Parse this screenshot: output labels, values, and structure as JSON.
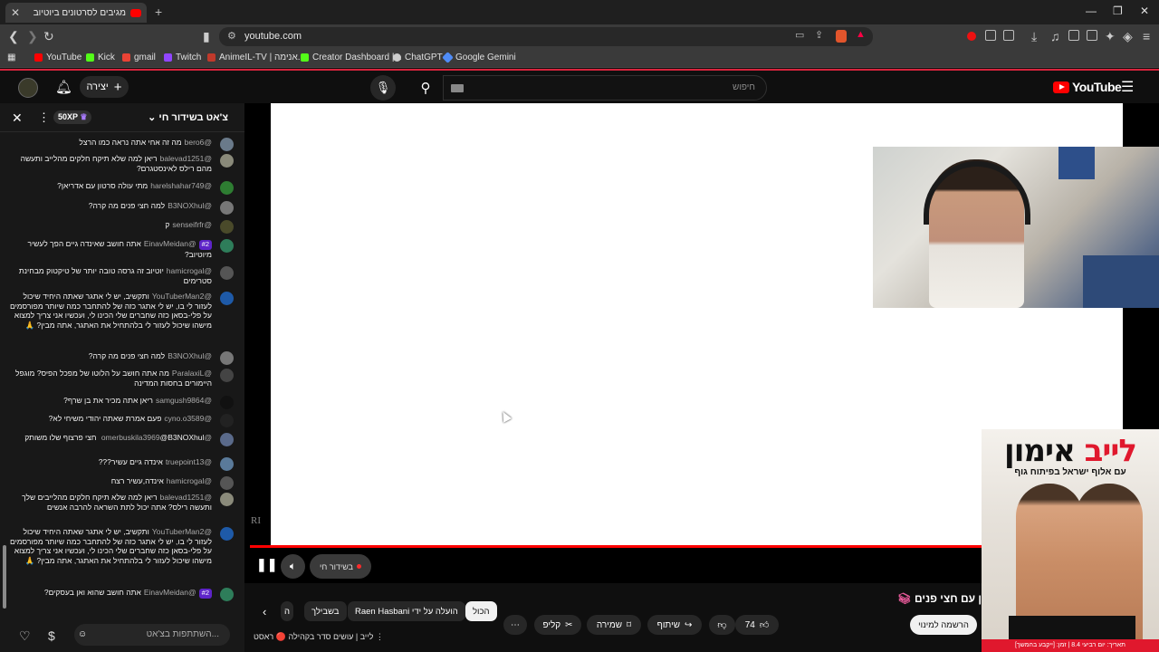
{
  "browser": {
    "tab_title": "מגיבים לסרטונים ביוטיוב",
    "url": "youtube.com",
    "bookmarks": [
      {
        "label": "YouTube",
        "color": "#ff0000"
      },
      {
        "label": "Kick",
        "color": "#53fc18"
      },
      {
        "label": "gmail",
        "color": "#ea4335"
      },
      {
        "label": "Twitch",
        "color": "#9146ff"
      },
      {
        "label": "AnimeIL-TV | אנימה...",
        "color": "#c0392b"
      },
      {
        "label": "Creator Dashboard |...",
        "color": "#53fc18"
      },
      {
        "label": "ChatGPT",
        "color": "#cccccc"
      },
      {
        "label": "Google Gemini",
        "color": "#4f8cf7"
      }
    ]
  },
  "header": {
    "create_label": "יצירה",
    "search_placeholder": "חיפוש",
    "logo_text": "YouTube"
  },
  "chat": {
    "title": "צ'אט בשידור חי",
    "xp_badge": "50XP",
    "input_placeholder": "השתתפות בצ'אט...",
    "messages": [
      {
        "author": "@bero6",
        "text": "מה זה אחי אתה נראה כמו הרצל",
        "avatar_color": "#6a7a8a"
      },
      {
        "author": "@balevad1251",
        "text": "ריאן למה שלא תיקח חלקים מהלייב ותעשה מהם רילס לאינסטגרם?",
        "avatar_color": "#8a8a7a"
      },
      {
        "author": "@harelshahar749",
        "text": "מתי עולה סרטון עם אדריאן?",
        "avatar_color": "#2e7d32"
      },
      {
        "author": "@B3NOXhul",
        "text": "למה חצי פנים מה קרה?",
        "avatar_color": "#777777"
      },
      {
        "author": "@senseifrfr",
        "text": "ק",
        "avatar_color": "#4a4a2a"
      },
      {
        "author": "@EinavMeidan",
        "badge": "#2",
        "text": "אתה חושב שאינדה גיים הפך לעשיר מיוטיוב?",
        "avatar_color": "#2e7d5a"
      },
      {
        "author": "@hamicrogal",
        "text": "יוטיוב זה גרסה טובה יותר של טיקטוק מבחינת סטרימים",
        "avatar_color": "#555555"
      },
      {
        "author": "@YouTuberMan2",
        "text": "ותקשיב, יש לי אתגר שאתה היחיד שיכול לעזור לי בו, יש לי אתגר כזה של להתחבר כמה שיותר מפורסמים על פלי-בסאן כזה שחברים שלי הכינו לי, ועכשיו אני צריך למצוא מישהו שיכול לעזור לי בלהתחיל את האתגר, אתה מבין? 🙏",
        "avatar_color": "#1e5aa8"
      },
      {
        "author": "@B3NOXhul",
        "text": "למה חצי פנים מה קרה?",
        "avatar_color": "#777777"
      },
      {
        "author": "@ParalaxiL",
        "text": "מה אתה חושב על הלוטו של מפכל הפיס? מוגפל היימורים בחסות המדינה",
        "avatar_color": "#444444"
      },
      {
        "author": "@samgush9864",
        "text": "ריאן אתה מכיר את בן שרף?",
        "avatar_color": "#111111"
      },
      {
        "author": "@cyno.o3589",
        "text": "פעם אמרת שאתה יהודי משיחי לא?",
        "avatar_color": "#222222"
      },
      {
        "author": "@omerbuskila3969",
        "text": "@B3NOXhul חצי פרצוף שלו משותק",
        "avatar_color": "#5a6a8a"
      },
      {
        "author": "@truepoint13",
        "text": "אינדה גיים עשיר???",
        "avatar_color": "#5a7a9a"
      },
      {
        "author": "@hamicrogal",
        "text": "אינדה,עשיר רצח",
        "avatar_color": "#555555"
      },
      {
        "author": "@balevad1251",
        "text": "ריאן למה שלא תיקח חלקים מהלייבים שלך ותעשה רילס? אתה יכול לתת השראה להרבה אנשים",
        "avatar_color": "#8a8a7a"
      },
      {
        "author": "@YouTuberMan2",
        "text": "ותקשיב, יש לי אתגר שאתה היחיד שיכול לעזור לי בו, יש לי אתגר כזה של להתחבר כמה שיותר מפורסמים על פלי-בסאן כזה שחברים שלי הכינו לי, ועכשיו אני צריך למצוא מישהו שיכול לעזור לי בלהתחיל את האתגר, אתה מבין? 🙏",
        "avatar_color": "#1e5aa8"
      },
      {
        "author": "@EinavMeidan",
        "badge": "#2",
        "text": "אתה חושב שהוא ואן בעסקים?",
        "avatar_color": "#2e7d5a"
      }
    ]
  },
  "player": {
    "live_label": "בשידור חי",
    "watermark": "RI"
  },
  "ad": {
    "headline_red": "לייב",
    "headline_black": "אימון",
    "subtitle": "עם אלוף ישראל בפיתוח גוף",
    "footer": "תאריך: יום רביעי 8.4 | זמן: [ייקבע בהמשך]"
  },
  "below": {
    "title": "ן עם חצי פנים",
    "subscribe_label": "הרשמה למינוי",
    "like_count": "74",
    "share_label": "שיתוף",
    "save_label": "שמירה",
    "clip_label": "קליפ",
    "chips": [
      "הכול",
      "הועלה על ידי Raen Hasbani",
      "בשבילך",
      "ה"
    ],
    "recommendation": "לייב | עושים סדר בקהילה 🔴 ראסט"
  }
}
